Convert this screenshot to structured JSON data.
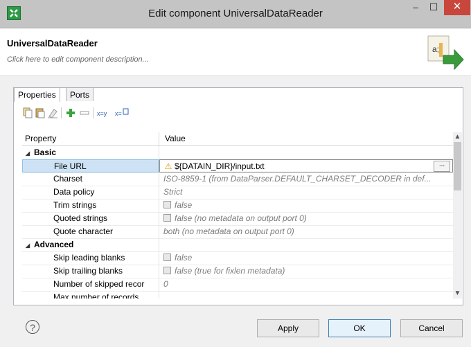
{
  "window": {
    "title": "Edit component UniversalDataReader",
    "min_label": "–",
    "max_label": "☐",
    "close_label": "✕"
  },
  "component": {
    "name": "UniversalDataReader",
    "description_hint": "Click here to edit component description..."
  },
  "tabs": [
    {
      "label": "Properties"
    },
    {
      "label": "Ports"
    }
  ],
  "toolbar": {
    "icons": [
      "copy-icon",
      "paste-icon",
      "clear-icon",
      "add-icon",
      "remove-icon",
      "x-eq-y-icon",
      "x-expression-icon"
    ]
  },
  "grid": {
    "col_property": "Property",
    "col_value": "Value",
    "rows": [
      {
        "type": "category",
        "name": "Basic"
      },
      {
        "type": "prop",
        "name": "File URL",
        "value": "${DATAIN_DIR}/input.txt",
        "selected": true,
        "warn": true
      },
      {
        "type": "prop",
        "name": "Charset",
        "value": "ISO-8859-1 (from DataParser.DEFAULT_CHARSET_DECODER in def..."
      },
      {
        "type": "prop",
        "name": "Data policy",
        "value": "Strict"
      },
      {
        "type": "prop",
        "name": "Trim strings",
        "value": "false",
        "checkbox": true
      },
      {
        "type": "prop",
        "name": "Quoted strings",
        "value": "false (no metadata on output port 0)",
        "checkbox": true
      },
      {
        "type": "prop",
        "name": "Quote character",
        "value": "both (no metadata on output port 0)"
      },
      {
        "type": "category",
        "name": "Advanced"
      },
      {
        "type": "prop",
        "name": "Skip leading blanks",
        "value": "false",
        "checkbox": true
      },
      {
        "type": "prop",
        "name": "Skip trailing blanks",
        "value": "false (true for fixlen metadata)",
        "checkbox": true
      },
      {
        "type": "prop",
        "name": "Number of skipped recor",
        "value": "0"
      },
      {
        "type": "prop",
        "name": "Max number of records",
        "value": ""
      }
    ]
  },
  "buttons": {
    "apply": "Apply",
    "ok": "OK",
    "cancel": "Cancel",
    "help": "?"
  },
  "colors": {
    "selection": "#cde3f5",
    "add_icon": "#3aa53a",
    "close_button": "#c9463d"
  }
}
